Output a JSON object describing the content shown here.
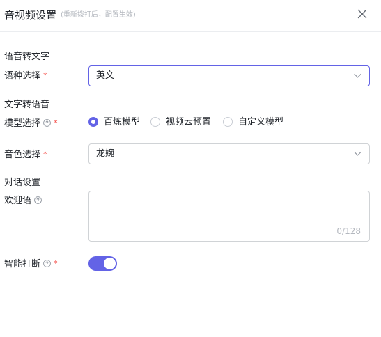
{
  "dialog": {
    "title": "音视频设置",
    "subtitle": "(重新拨打后，配置生效)",
    "close_icon": "close-icon"
  },
  "speech_to_text": {
    "section_title": "语音转文字",
    "language": {
      "label": "语种选择",
      "required": "*",
      "value": "英文"
    }
  },
  "text_to_speech": {
    "section_title": "文字转语音",
    "model": {
      "label": "模型选择",
      "required": "*",
      "options": [
        {
          "label": "百炼模型",
          "checked": true
        },
        {
          "label": "视频云预置",
          "checked": false
        },
        {
          "label": "自定义模型",
          "checked": false
        }
      ]
    },
    "voice": {
      "label": "音色选择",
      "required": "*",
      "value": "龙婉"
    }
  },
  "conversation": {
    "section_title": "对话设置",
    "greeting": {
      "label": "欢迎语",
      "value": "",
      "counter": "0/128"
    },
    "smart_interrupt": {
      "label": "智能打断",
      "required": "*",
      "enabled": true
    }
  },
  "colors": {
    "accent": "#6363e6",
    "required": "#f54a45",
    "border": "#d0d3d6",
    "muted": "#b4b8bf"
  }
}
